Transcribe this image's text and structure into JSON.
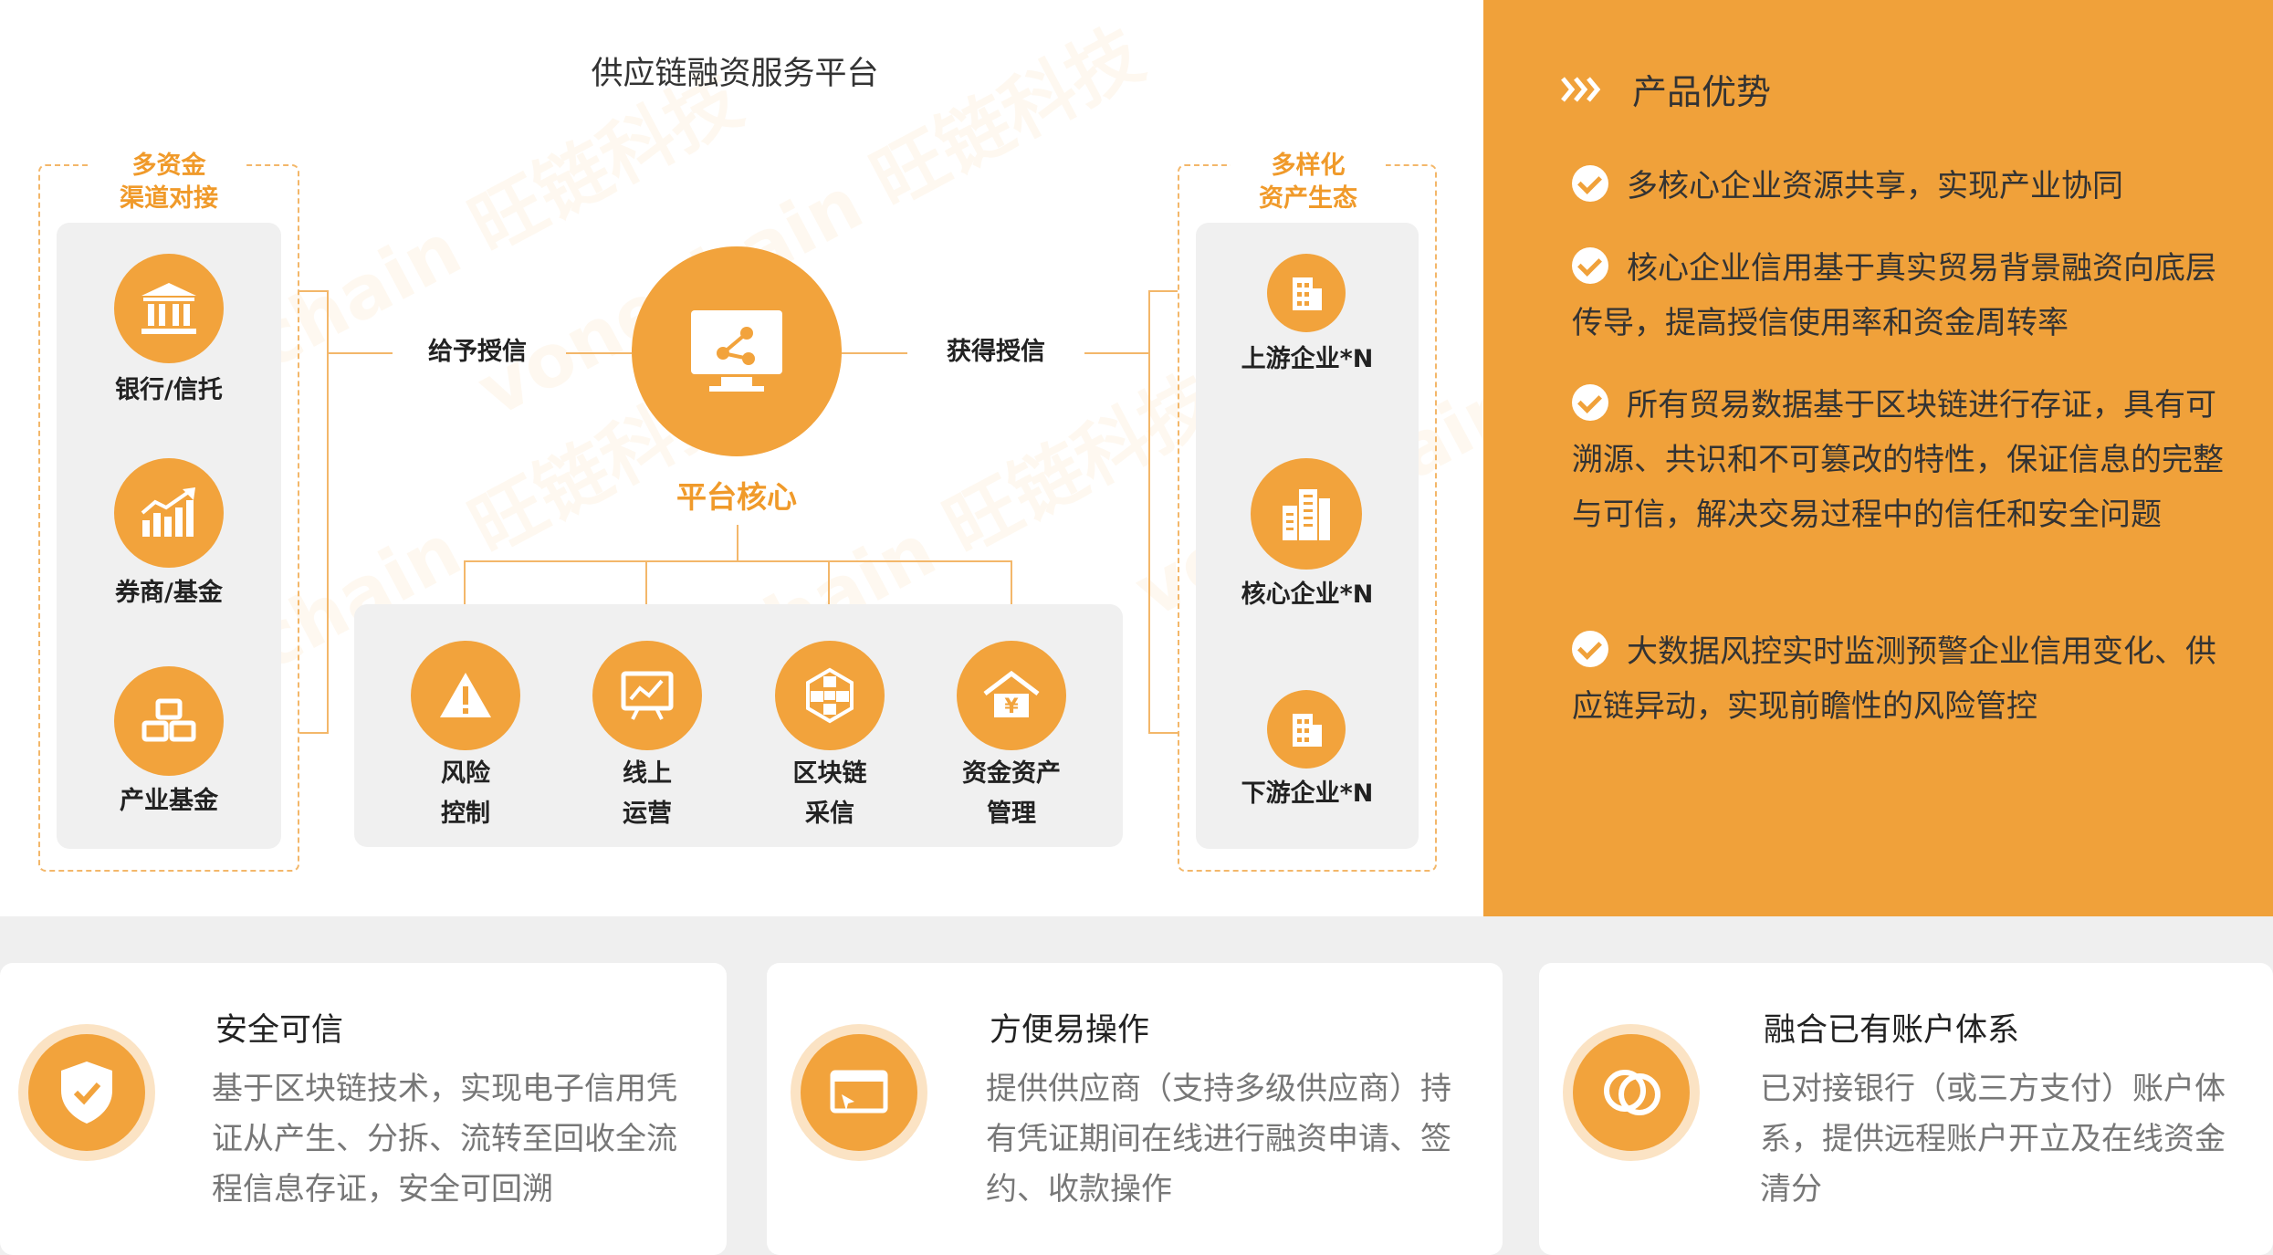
{
  "platform": {
    "title": "供应链融资服务平台",
    "core_label": "平台核心",
    "give_credit": "给予授信",
    "get_credit": "获得授信"
  },
  "left_group": {
    "title_line1": "多资金",
    "title_line2": "渠道对接",
    "items": [
      {
        "label": "银行/信托",
        "icon": "bank-icon"
      },
      {
        "label": "券商/基金",
        "icon": "chart-growth-icon"
      },
      {
        "label": "产业基金",
        "icon": "gold-bars-icon"
      }
    ]
  },
  "right_group": {
    "title_line1": "多样化",
    "title_line2": "资产生态",
    "items": [
      {
        "label": "上游企业*N",
        "icon": "building-small-icon"
      },
      {
        "label": "核心企业*N",
        "icon": "building-large-icon"
      },
      {
        "label": "下游企业*N",
        "icon": "building-small-icon"
      }
    ]
  },
  "services": [
    {
      "line1": "风险",
      "line2": "控制",
      "icon": "warning-icon"
    },
    {
      "line1": "线上",
      "line2": "运营",
      "icon": "presentation-icon"
    },
    {
      "line1": "区块链",
      "line2": "采信",
      "icon": "blockchain-icon"
    },
    {
      "line1": "资金资产",
      "line2": "管理",
      "icon": "yen-house-icon"
    }
  ],
  "watermark": "vonechain 旺链科技",
  "advantages": {
    "heading": "产品优势",
    "items": [
      "多核心企业资源共享，实现产业协同",
      "核心企业信用基于真实贸易背景融资向底层传导，提高授信使用率和资金周转率",
      "所有贸易数据基于区块链进行存证，具有可溯源、共识和不可篡改的特性，保证信息的完整与可信，解决交易过程中的信任和安全问题",
      "大数据风控实时监测预警企业信用变化、供应链异动，实现前瞻性的风险管控"
    ]
  },
  "cards": [
    {
      "title": "安全可信",
      "desc": "基于区块链技术，实现电子信用凭证从产生、分拆、流转至回收全流程信息存证，安全可回溯",
      "icon": "shield-check-icon"
    },
    {
      "title": "方便易操作",
      "desc": "提供供应商（支持多级供应商）持有凭证期间在线进行融资申请、签约、收款操作",
      "icon": "screen-cursor-icon"
    },
    {
      "title": "融合已有账户体系",
      "desc": "已对接银行（或三方支付）账户体系，提供远程账户开立及在线资金清分",
      "icon": "linked-rings-icon"
    }
  ],
  "colors": {
    "accent": "#f2a33c",
    "panel": "#f0a13a",
    "line": "#f3b76a",
    "gray": "#f0f0f0"
  }
}
